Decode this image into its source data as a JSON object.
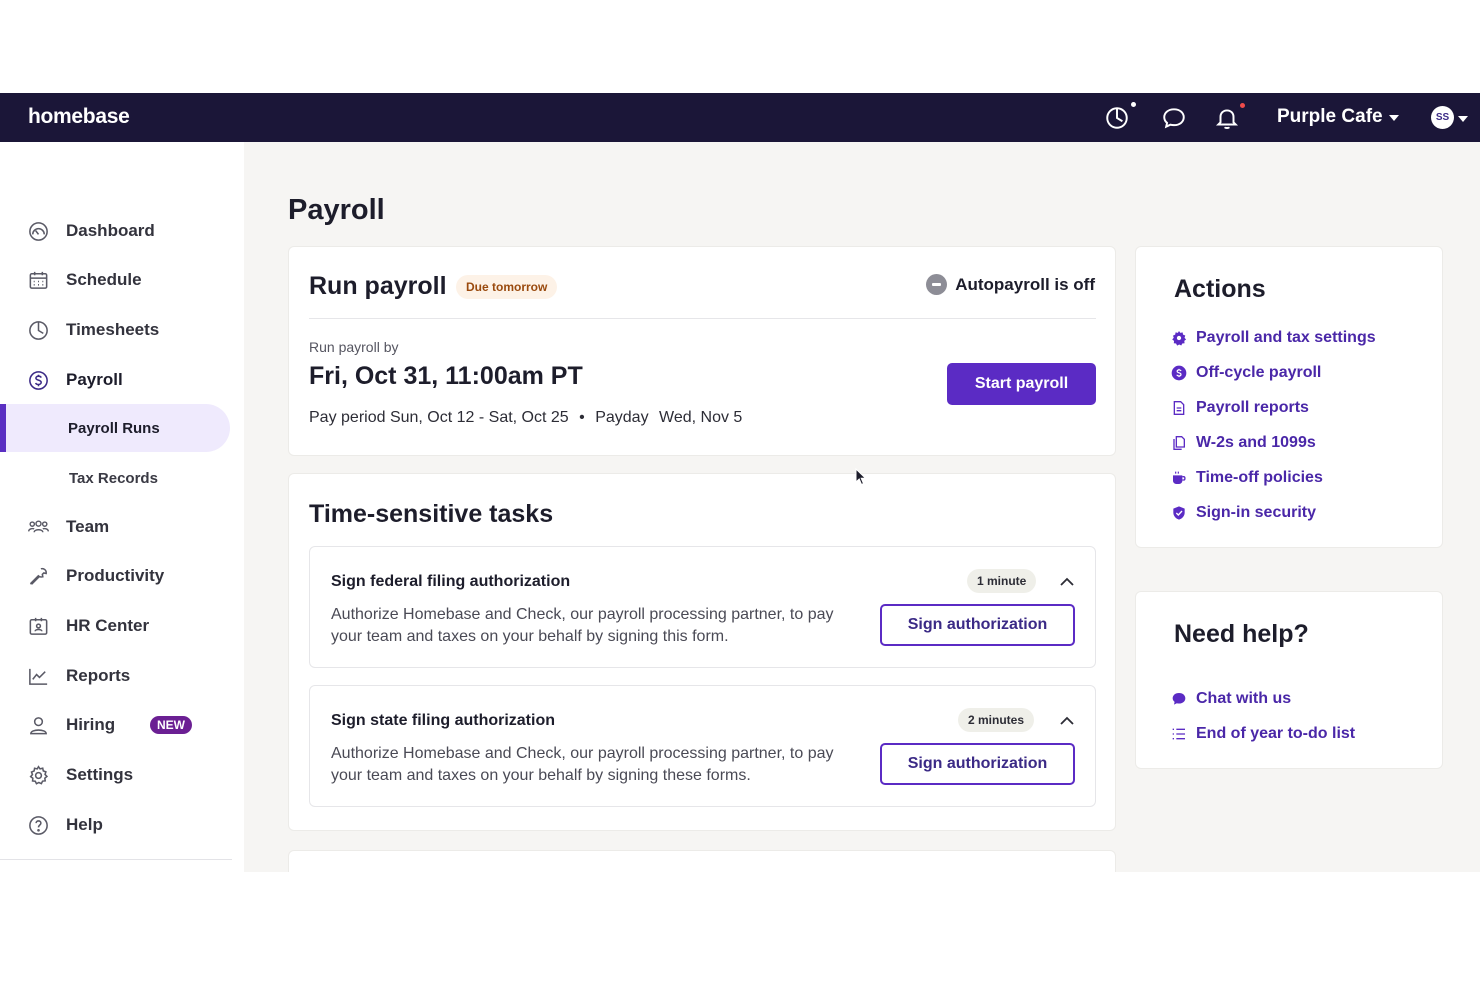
{
  "topbar": {
    "logo": "homebase",
    "location": "Purple Cafe",
    "avatar_initials": "SS",
    "icons": [
      "clock-icon",
      "chat-icon",
      "bell-icon"
    ],
    "dot_colors": {
      "clock": "#ffffff",
      "bell": "#f04b4b"
    }
  },
  "sidebar": {
    "items": [
      {
        "label": "Dashboard",
        "icon": "dashboard-icon"
      },
      {
        "label": "Schedule",
        "icon": "calendar-icon"
      },
      {
        "label": "Timesheets",
        "icon": "clock-icon"
      },
      {
        "label": "Payroll",
        "icon": "dollar-icon"
      },
      {
        "label": "Team",
        "icon": "team-icon"
      },
      {
        "label": "Productivity",
        "icon": "wrench-icon"
      },
      {
        "label": "HR Center",
        "icon": "hr-icon"
      },
      {
        "label": "Reports",
        "icon": "chart-icon"
      },
      {
        "label": "Hiring",
        "icon": "person-icon",
        "badge": "NEW"
      },
      {
        "label": "Settings",
        "icon": "gear-icon"
      },
      {
        "label": "Help",
        "icon": "help-icon"
      }
    ],
    "subitems": [
      {
        "label": "Payroll Runs"
      },
      {
        "label": "Tax Records"
      }
    ]
  },
  "main": {
    "title": "Payroll",
    "run_payroll": {
      "title": "Run payroll",
      "badge": "Due tomorrow",
      "autopayroll": "Autopayroll is off",
      "run_by_label": "Run payroll by",
      "run_by_date": "Fri, Oct 31, 11:00am PT",
      "pay_period": "Pay period Sun, Oct 12 - Sat, Oct 25",
      "payday_label": "Payday",
      "payday_date": "Wed, Nov 5",
      "button": "Start payroll"
    },
    "tasks": {
      "title": "Time-sensitive tasks",
      "items": [
        {
          "title": "Sign federal filing authorization",
          "time": "1 minute",
          "description": "Authorize Homebase and Check, our payroll processing partner, to pay your team and taxes on your behalf by signing this form.",
          "button": "Sign authorization"
        },
        {
          "title": "Sign state filing authorization",
          "time": "2 minutes",
          "description": "Authorize Homebase and Check, our payroll processing partner, to pay your team and taxes on your behalf by signing these forms.",
          "button": "Sign authorization"
        }
      ]
    }
  },
  "actions": {
    "title": "Actions",
    "links": [
      {
        "label": "Payroll and tax settings",
        "icon": "gear-icon"
      },
      {
        "label": "Off-cycle payroll",
        "icon": "dollar-icon"
      },
      {
        "label": "Payroll reports",
        "icon": "document-icon"
      },
      {
        "label": "W-2s and 1099s",
        "icon": "documents-icon"
      },
      {
        "label": "Time-off policies",
        "icon": "mug-icon"
      },
      {
        "label": "Sign-in security",
        "icon": "shield-icon"
      }
    ]
  },
  "help": {
    "title": "Need help?",
    "links": [
      {
        "label": "Chat with us",
        "icon": "chat-icon"
      },
      {
        "label": "End of year to-do list",
        "icon": "list-icon"
      }
    ]
  },
  "colors": {
    "topbar": "#1b1638",
    "accent": "#5b2bc4",
    "link": "#4a27a8",
    "active_bg": "#efeafd"
  }
}
